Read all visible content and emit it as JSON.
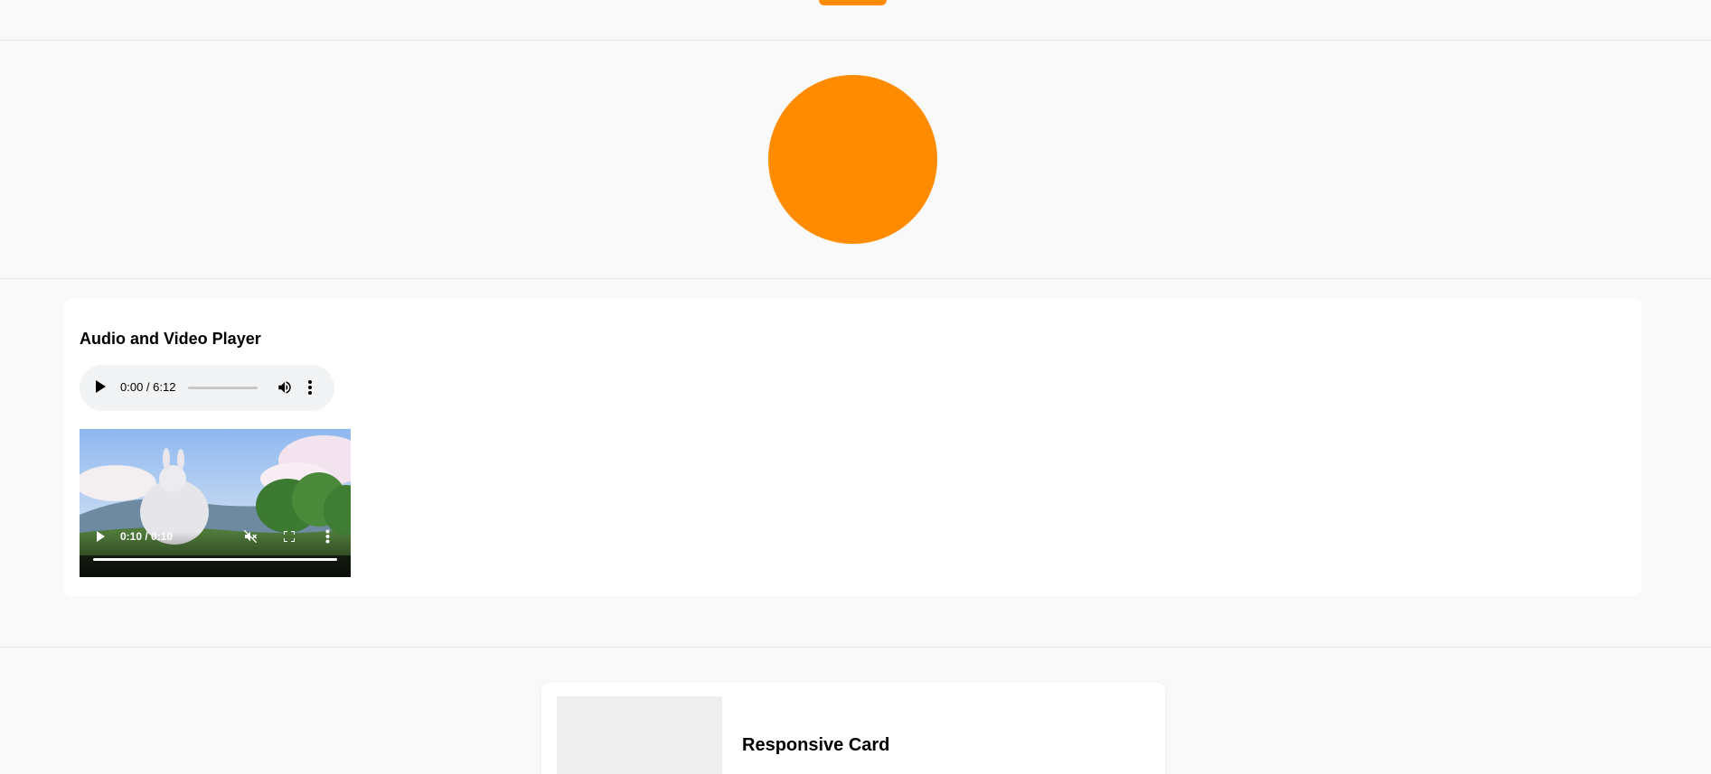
{
  "colors": {
    "accent": "#ff8c00",
    "background": "#f9f9f9",
    "card": "#ffffff"
  },
  "media_section": {
    "title": "Audio and Video Player",
    "audio": {
      "time": "0:00 / 6:12",
      "icons": [
        "play-icon",
        "volume-icon",
        "more-options-icon"
      ]
    },
    "video": {
      "time": "0:10 / 0:10",
      "progress": 1.0,
      "icons": [
        "play-icon",
        "muted-icon",
        "fullscreen-icon",
        "more-options-icon"
      ]
    }
  },
  "responsive_card": {
    "title": "Responsive Card"
  }
}
